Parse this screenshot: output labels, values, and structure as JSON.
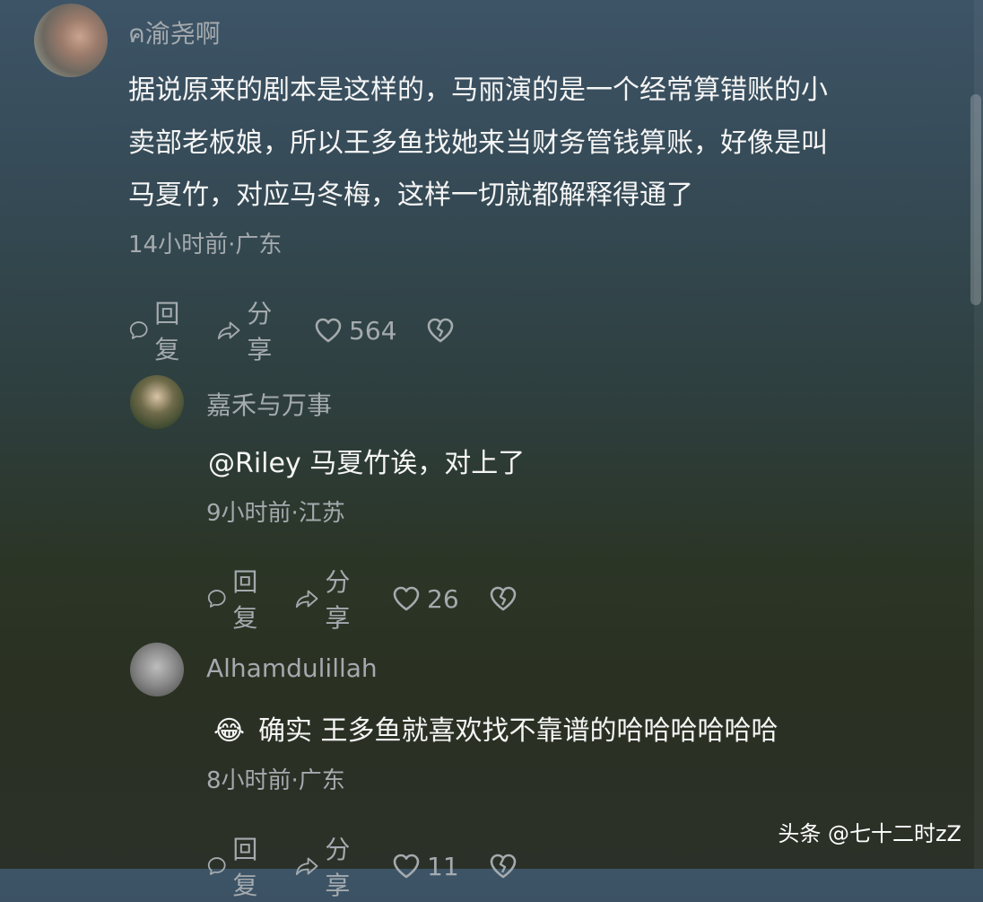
{
  "comments": [
    {
      "username": "ค渝尧啊",
      "lines": [
        "据说原来的剧本是这样的，马丽演的是一个经常算错账的小",
        "卖部老板娘，所以王多鱼找她来当财务管钱算账，好像是叫",
        "马夏竹，对应马冬梅，这样一切就都解释得通了"
      ],
      "meta": "14小时前·广东",
      "reply_label": "回复",
      "share_label": "分享",
      "like_count": "564"
    },
    {
      "username": "嘉禾与万事",
      "lines": [
        "@Riley 马夏竹诶，对上了"
      ],
      "meta": "9小时前·江苏",
      "reply_label": "回复",
      "share_label": "分享",
      "like_count": "26"
    },
    {
      "username": "Alhamdulillah",
      "emoji": "😂",
      "lines": [
        "确实 王多鱼就喜欢找不靠谱的哈哈哈哈哈哈"
      ],
      "meta": "8小时前·广东",
      "reply_label": "回复",
      "share_label": "分享",
      "like_count": "11"
    }
  ],
  "watermark": "头条 @七十二时zZ",
  "icons": {
    "reply": "speech-bubble-icon",
    "share": "share-arrow-icon",
    "like": "heart-icon",
    "dislike": "broken-heart-icon"
  }
}
